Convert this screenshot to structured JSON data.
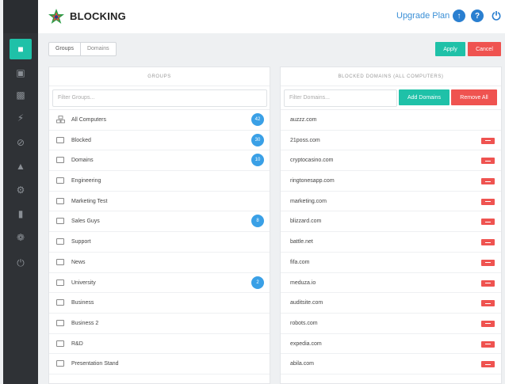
{
  "header": {
    "brand": "BLOCKING",
    "upgrade_label": "Upgrade Plan",
    "up_icon": "arrow-up-icon",
    "help_icon": "question-icon",
    "power_icon": "power-icon"
  },
  "sidebar": {
    "items": [
      {
        "icon": "dashboard-icon",
        "active": true
      },
      {
        "icon": "reports-icon"
      },
      {
        "icon": "computers-icon"
      },
      {
        "icon": "bolt-icon"
      },
      {
        "icon": "blocking-icon"
      },
      {
        "icon": "alerts-icon"
      },
      {
        "icon": "settings-icon"
      },
      {
        "icon": "documents-icon"
      },
      {
        "icon": "gear-icon"
      },
      {
        "icon": "power-icon"
      }
    ]
  },
  "toolbar": {
    "tab_groups": "Groups",
    "tab_domains": "Domains",
    "apply": "Apply",
    "cancel": "Cancel"
  },
  "groups_panel": {
    "title": "GROUPS",
    "filter_placeholder": "Filter Groups...",
    "items": [
      {
        "label": "All Computers",
        "count": "42"
      },
      {
        "label": "Blocked",
        "count": "30"
      },
      {
        "label": "Domains",
        "count": "10"
      },
      {
        "label": "Engineering",
        "count": ""
      },
      {
        "label": "Marketing Test",
        "count": ""
      },
      {
        "label": "Sales Guys",
        "count": "8"
      },
      {
        "label": "Support",
        "count": ""
      },
      {
        "label": "News",
        "count": ""
      },
      {
        "label": "University",
        "count": "2"
      },
      {
        "label": "Business",
        "count": ""
      },
      {
        "label": "Business 2",
        "count": ""
      },
      {
        "label": "R&D",
        "count": ""
      },
      {
        "label": "Presentation Stand",
        "count": ""
      }
    ]
  },
  "domains_panel": {
    "title": "BLOCKED DOMAINS (ALL COMPUTERS)",
    "filter_placeholder": "Filter Domains...",
    "add_label": "Add Domains",
    "remove_all_label": "Remove All",
    "items": [
      {
        "domain": "auzzz.com",
        "removable": false
      },
      {
        "domain": "21poss.com",
        "removable": true
      },
      {
        "domain": "cryptocasino.com",
        "removable": true
      },
      {
        "domain": "ringtonesapp.com",
        "removable": true
      },
      {
        "domain": "marketing.com",
        "removable": true
      },
      {
        "domain": "blizzard.com",
        "removable": true
      },
      {
        "domain": "battle.net",
        "removable": true
      },
      {
        "domain": "fifa.com",
        "removable": true
      },
      {
        "domain": "meduza.io",
        "removable": true
      },
      {
        "domain": "auditsite.com",
        "removable": true
      },
      {
        "domain": "robots.com",
        "removable": true
      },
      {
        "domain": "expedia.com",
        "removable": true
      },
      {
        "domain": "abila.com",
        "removable": true
      }
    ]
  },
  "colors": {
    "accent": "#1fc1a8",
    "danger": "#ef5350",
    "badge": "#3aa0e6",
    "link": "#3a8fd6",
    "sidebar": "#2f3236"
  }
}
